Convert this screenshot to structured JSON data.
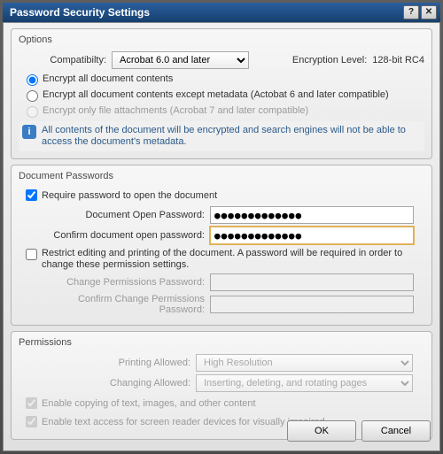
{
  "window": {
    "title": "Password Security Settings",
    "help_glyph": "?",
    "close_glyph": "✕"
  },
  "options": {
    "group_title": "Options",
    "compat_label": "Compatibilty:",
    "compat_value": "Acrobat 6.0 and later",
    "encryption_label": "Encryption Level:",
    "encryption_value": "128-bit RC4",
    "r1": "Encrypt all document contents",
    "r2": "Encrypt all document contents except metadata (Actobat 6 and later compatible)",
    "r3": "Encrypt only file attachments (Acrobat 7 and later compatible)",
    "info": "All contents of the document will be encrypted and search engines will not be able to access the document's metadata."
  },
  "passwords": {
    "group_title": "Document Passwords",
    "chk_open": "Require password to open the document",
    "open_label": "Document Open Password:",
    "open_value": "●●●●●●●●●●●●●",
    "confirm_label": "Confirm document open password:",
    "confirm_value": "●●●●●●●●●●●●●",
    "chk_restrict": "Restrict editing and printing of the document. A password will be required in order to change these permission settings.",
    "change_label": "Change Permissions Password:",
    "confirm_change_label": "Confirm Change Permissions Password:"
  },
  "permissions": {
    "group_title": "Permissions",
    "printing_label": "Printing Allowed:",
    "printing_value": "High Resolution",
    "changing_label": "Changing Allowed:",
    "changing_value": "Inserting, deleting, and rotating pages",
    "chk_copy": "Enable copying of text, images, and other content",
    "chk_access": "Enable text access for screen reader devices for visually impaired"
  },
  "buttons": {
    "ok": "OK",
    "cancel": "Cancel"
  }
}
